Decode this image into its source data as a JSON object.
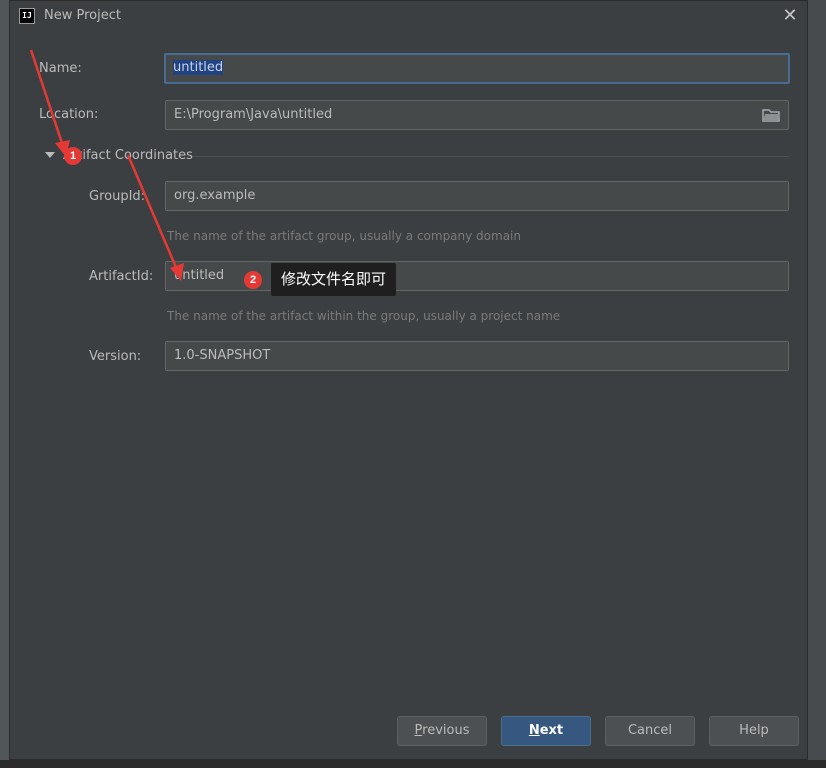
{
  "window": {
    "title": "New Project"
  },
  "form": {
    "name_label": "Name:",
    "name_value": "untitled",
    "location_label": "Location:",
    "location_value": "E:\\Program\\Java\\untitled",
    "section_title": "Artifact Coordinates",
    "groupid_label": "GroupId:",
    "groupid_value": "org.example",
    "groupid_hint": "The name of the artifact group, usually a company domain",
    "artifactid_label": "ArtifactId:",
    "artifactid_value": "untitled",
    "artifactid_hint": "The name of the artifact within the group, usually a project name",
    "version_label": "Version:",
    "version_value": "1.0-SNAPSHOT"
  },
  "buttons": {
    "previous_mn": "P",
    "previous_rest": "revious",
    "next_mn": "N",
    "next_rest": "ext",
    "cancel": "Cancel",
    "help": "Help"
  },
  "annotations": {
    "badge1": "1",
    "badge2": "2",
    "callout": "修改文件名即可"
  },
  "icons": {
    "app": "intellij-idea-icon",
    "close": "close-icon",
    "folder": "folder-icon",
    "toggle": "triangle-down-icon"
  },
  "colors": {
    "accent": "#365880",
    "focus_border": "#466d94",
    "annotation_red": "#e53935"
  }
}
